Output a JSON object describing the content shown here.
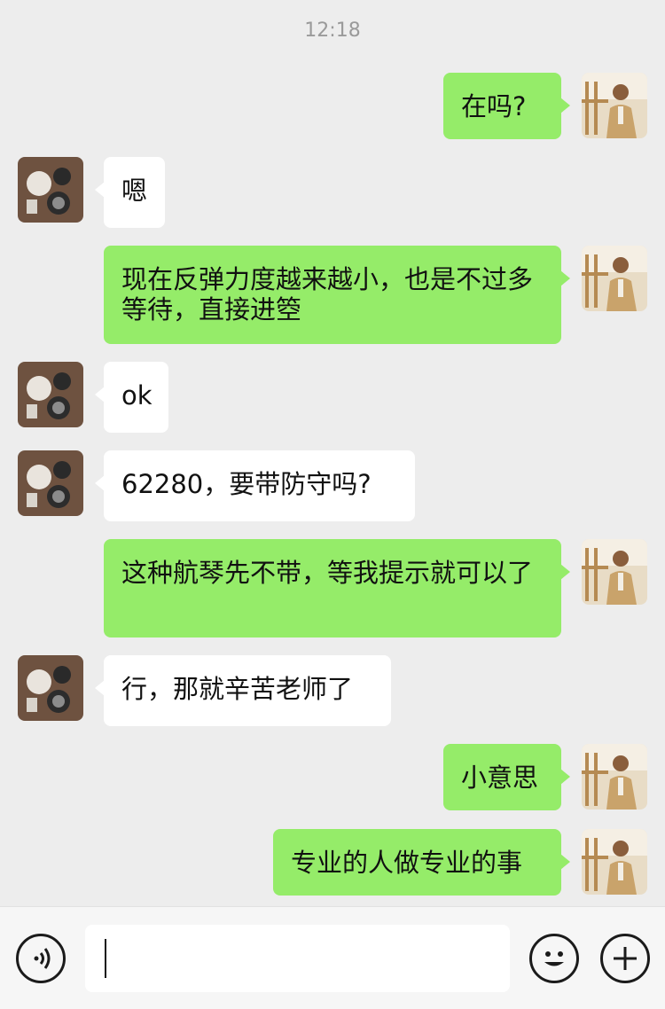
{
  "header": {
    "time": "12:18"
  },
  "messages": [
    {
      "from": "me",
      "text": "在吗?"
    },
    {
      "from": "other",
      "text": "嗯"
    },
    {
      "from": "me",
      "text": "现在反弹力度越来越小，也是不过多等待，直接进箜"
    },
    {
      "from": "other",
      "text": "ok"
    },
    {
      "from": "other",
      "text": "62280，要带防守吗?"
    },
    {
      "from": "me",
      "text": "这种航琴先不带，等我提示就可以了"
    },
    {
      "from": "other",
      "text": "行，那就辛苦老师了"
    },
    {
      "from": "me",
      "text": "小意思"
    },
    {
      "from": "me",
      "text": "专业的人做专业的事"
    }
  ],
  "input_bar": {
    "voice_icon": "voice-icon",
    "emoji_icon": "emoji-icon",
    "plus_icon": "plus-icon",
    "input_value": ""
  },
  "colors": {
    "background": "#ededed",
    "my_bubble": "#95ec69",
    "other_bubble": "#ffffff"
  }
}
